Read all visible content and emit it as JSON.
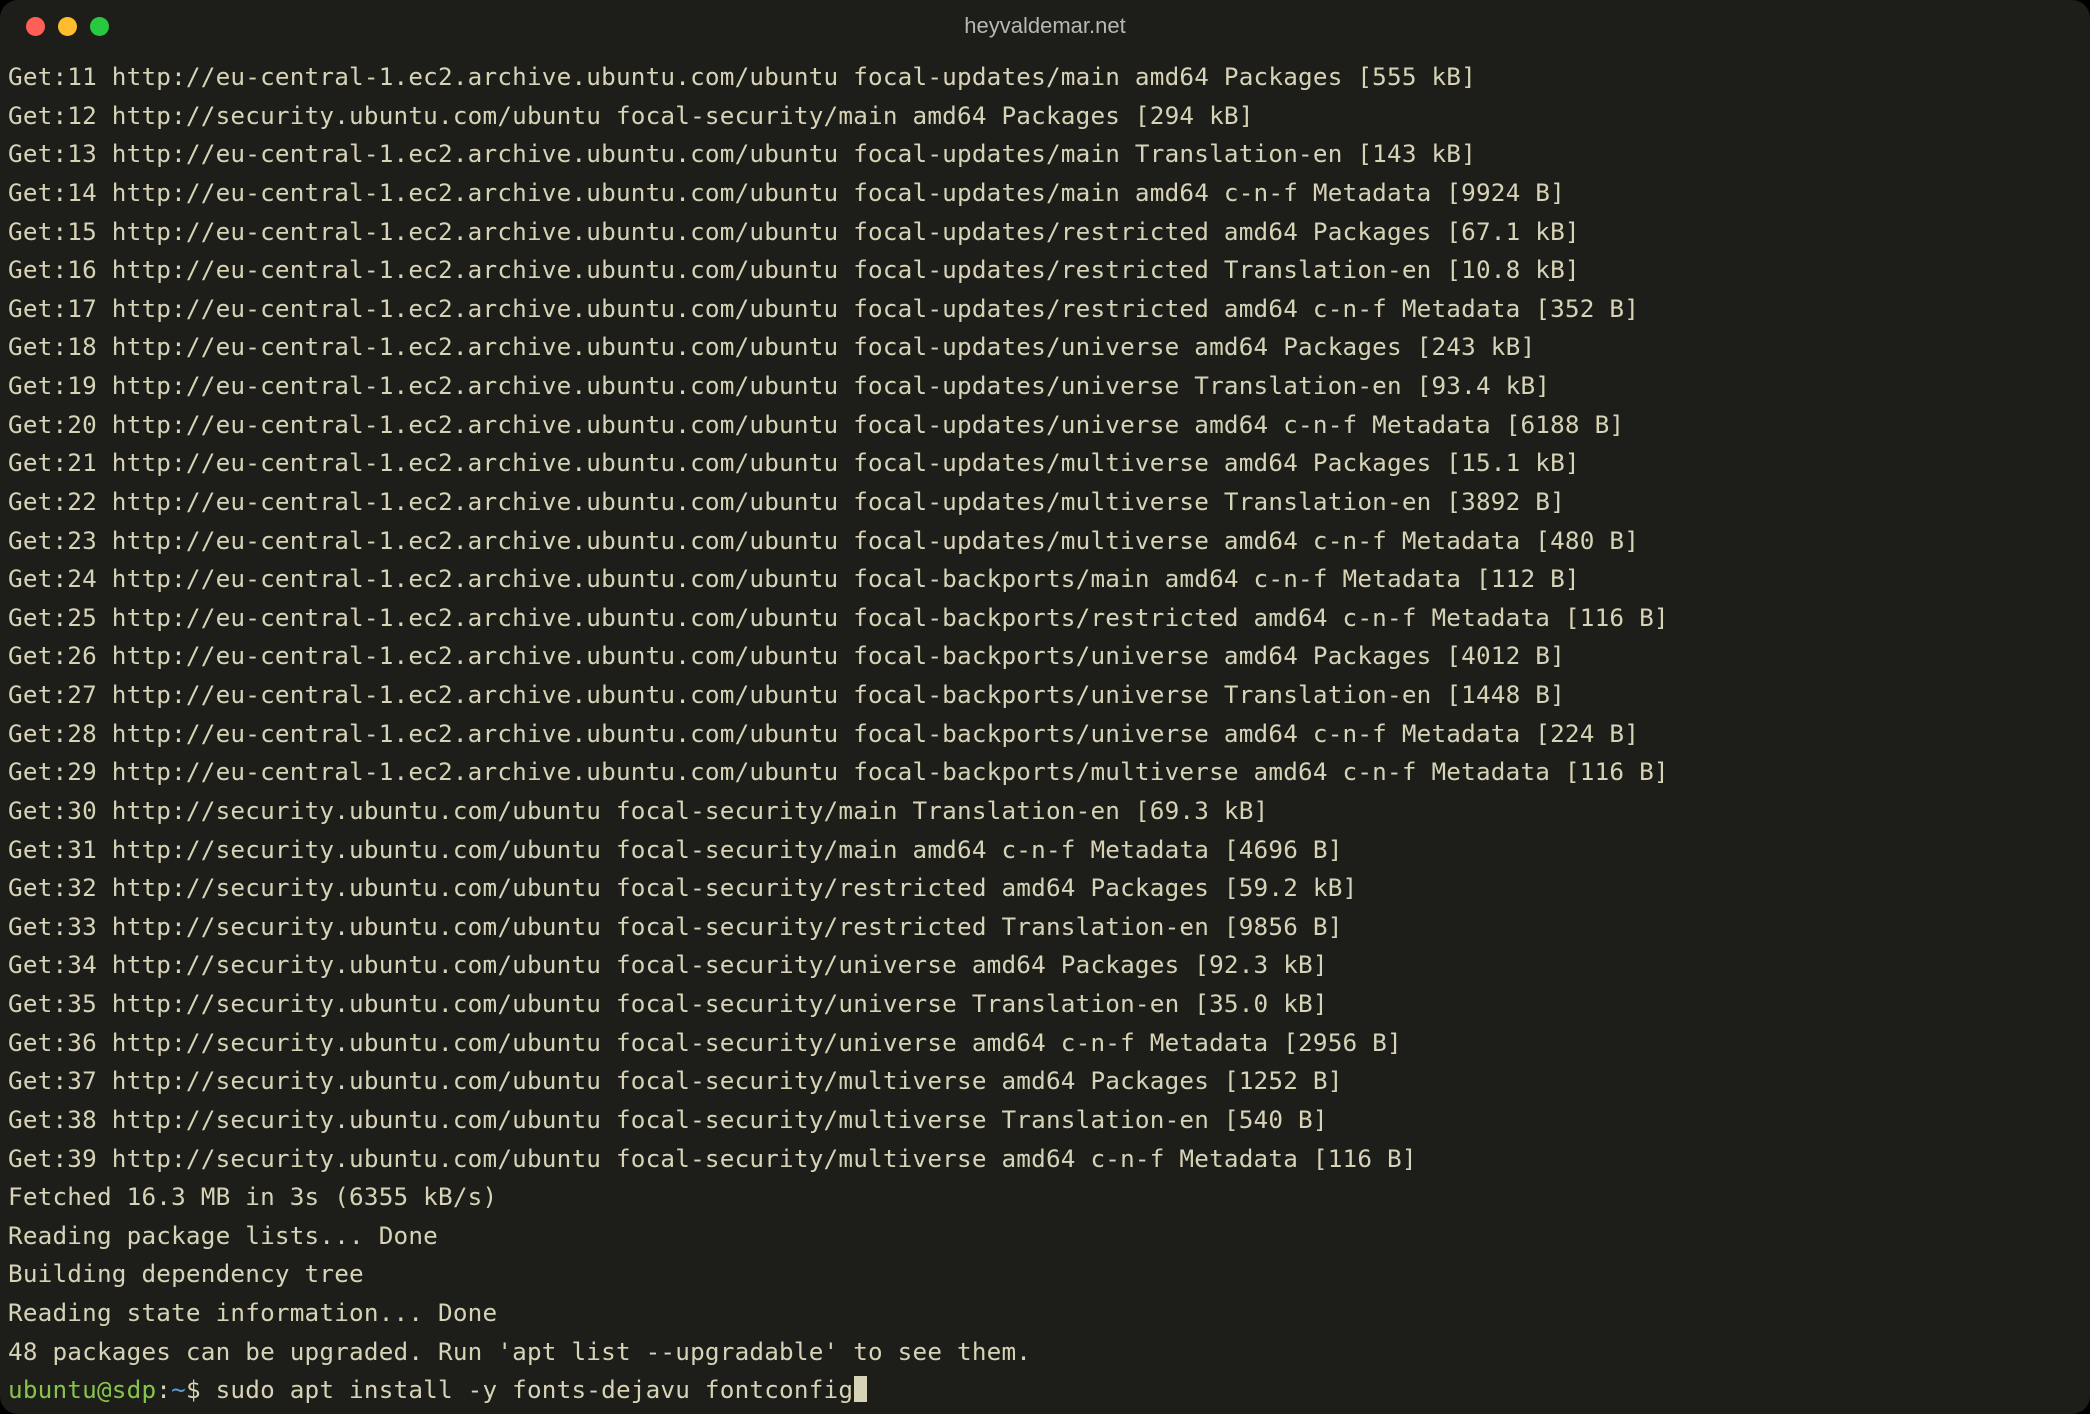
{
  "window": {
    "title": "heyvaldemar.net"
  },
  "output_lines": [
    "Get:11 http://eu-central-1.ec2.archive.ubuntu.com/ubuntu focal-updates/main amd64 Packages [555 kB]",
    "Get:12 http://security.ubuntu.com/ubuntu focal-security/main amd64 Packages [294 kB]",
    "Get:13 http://eu-central-1.ec2.archive.ubuntu.com/ubuntu focal-updates/main Translation-en [143 kB]",
    "Get:14 http://eu-central-1.ec2.archive.ubuntu.com/ubuntu focal-updates/main amd64 c-n-f Metadata [9924 B]",
    "Get:15 http://eu-central-1.ec2.archive.ubuntu.com/ubuntu focal-updates/restricted amd64 Packages [67.1 kB]",
    "Get:16 http://eu-central-1.ec2.archive.ubuntu.com/ubuntu focal-updates/restricted Translation-en [10.8 kB]",
    "Get:17 http://eu-central-1.ec2.archive.ubuntu.com/ubuntu focal-updates/restricted amd64 c-n-f Metadata [352 B]",
    "Get:18 http://eu-central-1.ec2.archive.ubuntu.com/ubuntu focal-updates/universe amd64 Packages [243 kB]",
    "Get:19 http://eu-central-1.ec2.archive.ubuntu.com/ubuntu focal-updates/universe Translation-en [93.4 kB]",
    "Get:20 http://eu-central-1.ec2.archive.ubuntu.com/ubuntu focal-updates/universe amd64 c-n-f Metadata [6188 B]",
    "Get:21 http://eu-central-1.ec2.archive.ubuntu.com/ubuntu focal-updates/multiverse amd64 Packages [15.1 kB]",
    "Get:22 http://eu-central-1.ec2.archive.ubuntu.com/ubuntu focal-updates/multiverse Translation-en [3892 B]",
    "Get:23 http://eu-central-1.ec2.archive.ubuntu.com/ubuntu focal-updates/multiverse amd64 c-n-f Metadata [480 B]",
    "Get:24 http://eu-central-1.ec2.archive.ubuntu.com/ubuntu focal-backports/main amd64 c-n-f Metadata [112 B]",
    "Get:25 http://eu-central-1.ec2.archive.ubuntu.com/ubuntu focal-backports/restricted amd64 c-n-f Metadata [116 B]",
    "Get:26 http://eu-central-1.ec2.archive.ubuntu.com/ubuntu focal-backports/universe amd64 Packages [4012 B]",
    "Get:27 http://eu-central-1.ec2.archive.ubuntu.com/ubuntu focal-backports/universe Translation-en [1448 B]",
    "Get:28 http://eu-central-1.ec2.archive.ubuntu.com/ubuntu focal-backports/universe amd64 c-n-f Metadata [224 B]",
    "Get:29 http://eu-central-1.ec2.archive.ubuntu.com/ubuntu focal-backports/multiverse amd64 c-n-f Metadata [116 B]",
    "Get:30 http://security.ubuntu.com/ubuntu focal-security/main Translation-en [69.3 kB]",
    "Get:31 http://security.ubuntu.com/ubuntu focal-security/main amd64 c-n-f Metadata [4696 B]",
    "Get:32 http://security.ubuntu.com/ubuntu focal-security/restricted amd64 Packages [59.2 kB]",
    "Get:33 http://security.ubuntu.com/ubuntu focal-security/restricted Translation-en [9856 B]",
    "Get:34 http://security.ubuntu.com/ubuntu focal-security/universe amd64 Packages [92.3 kB]",
    "Get:35 http://security.ubuntu.com/ubuntu focal-security/universe Translation-en [35.0 kB]",
    "Get:36 http://security.ubuntu.com/ubuntu focal-security/universe amd64 c-n-f Metadata [2956 B]",
    "Get:37 http://security.ubuntu.com/ubuntu focal-security/multiverse amd64 Packages [1252 B]",
    "Get:38 http://security.ubuntu.com/ubuntu focal-security/multiverse Translation-en [540 B]",
    "Get:39 http://security.ubuntu.com/ubuntu focal-security/multiverse amd64 c-n-f Metadata [116 B]",
    "Fetched 16.3 MB in 3s (6355 kB/s)",
    "Reading package lists... Done",
    "Building dependency tree",
    "Reading state information... Done",
    "48 packages can be upgraded. Run 'apt list --upgradable' to see them."
  ],
  "prompt": {
    "user": "ubuntu",
    "at": "@",
    "host": "sdp",
    "colon": ":",
    "path": "~",
    "symbol": "$ ",
    "command": "sudo apt install -y fonts-dejavu fontconfig"
  }
}
